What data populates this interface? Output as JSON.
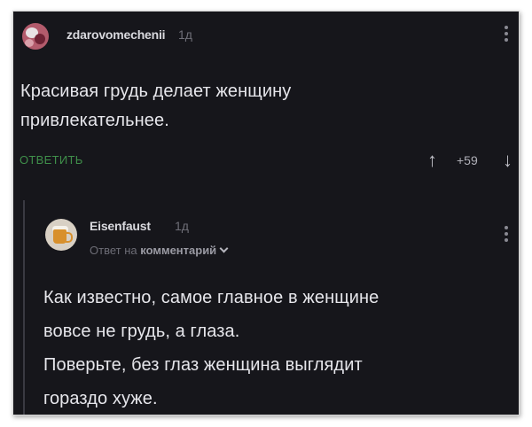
{
  "parent_comment": {
    "author": "zdarovomechenii",
    "time": "1д",
    "text": "Красивая грудь делает женщину привлекательнее.",
    "reply_label": "ОТВЕТИТЬ",
    "rating": "+59",
    "upvote_icon": "↑",
    "downvote_icon": "↓"
  },
  "reply_comment": {
    "author": "Eisenfaust",
    "time": "1д",
    "reply_prefix": "Ответ на",
    "reply_target": "комментарий",
    "text_lines": [
      "Как известно, самое главное в женщине",
      "вовсе не грудь, а глаза.",
      "Поверьте, без глаз женщина выглядит",
      "гораздо хуже."
    ]
  },
  "icons": {
    "menu": "vertical-dots-icon",
    "expand": "chevron-down-icon"
  }
}
